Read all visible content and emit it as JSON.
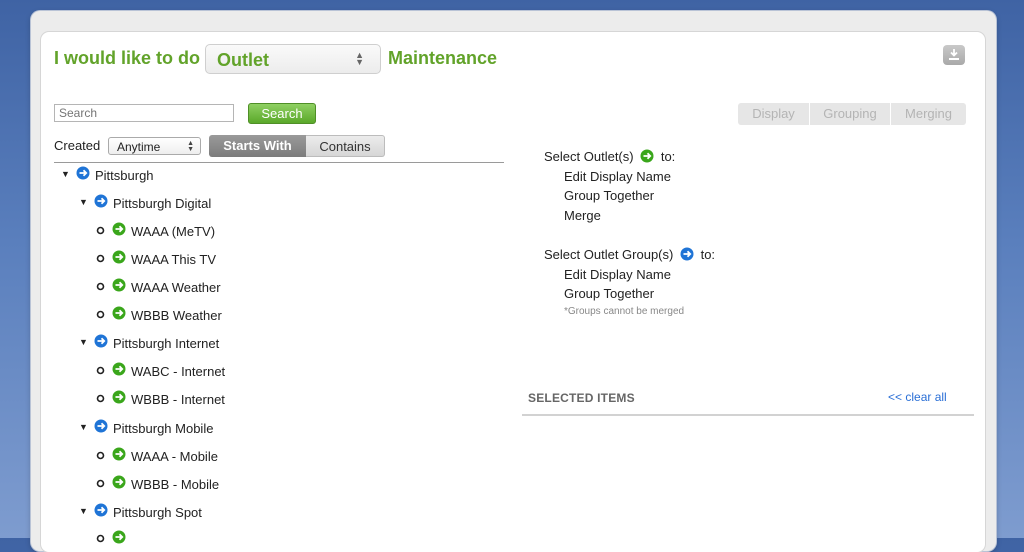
{
  "header": {
    "prefix": "I would like to do",
    "selected_type": "Outlet",
    "suffix": "Maintenance"
  },
  "search": {
    "placeholder": "Search",
    "button_label": "Search"
  },
  "actions": [
    "Display",
    "Grouping",
    "Merging"
  ],
  "filter": {
    "created_label": "Created",
    "created_value": "Anytime",
    "toggle_on": "Starts With",
    "toggle_off": "Contains"
  },
  "tree": {
    "root": "Pittsburgh",
    "groups": [
      {
        "label": "Pittsburgh Digital",
        "items": [
          "WAAA (MeTV)",
          "WAAA This TV",
          "WAAA Weather",
          "WBBB Weather"
        ]
      },
      {
        "label": "Pittsburgh Internet",
        "items": [
          "WABC - Internet",
          "WBBB - Internet"
        ]
      },
      {
        "label": "Pittsburgh Mobile",
        "items": [
          "WAAA - Mobile",
          "WBBB - Mobile"
        ]
      },
      {
        "label": "Pittsburgh Spot",
        "items": []
      }
    ]
  },
  "help": {
    "outlets": {
      "title": "Select Outlet(s)",
      "to": "to:",
      "steps": [
        "Edit Display Name",
        "Group Together",
        "Merge"
      ]
    },
    "groups": {
      "title": "Select Outlet Group(s)",
      "to": "to:",
      "steps": [
        "Edit Display Name",
        "Group Together"
      ],
      "note": "*Groups cannot be merged"
    }
  },
  "selected": {
    "title": "SELECTED ITEMS",
    "clear_label": "<< clear all"
  },
  "colors": {
    "accent_green": "#62a32a",
    "link_blue": "#2a6fd6",
    "node_blue": "#1f74d6",
    "node_green": "#3aa61b"
  },
  "icons": {
    "group_node": "blue-arrow-circle-icon",
    "outlet_node": "green-arrow-circle-icon",
    "download": "download-icon"
  }
}
